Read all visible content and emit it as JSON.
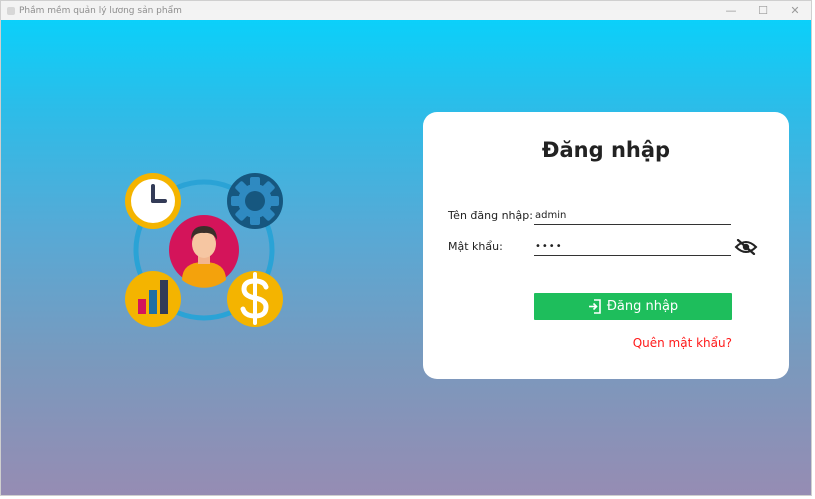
{
  "window": {
    "title": "Phầm mềm quản lý lương sản phẩm",
    "controls": {
      "minimize": "—",
      "maximize": "☐",
      "close": "✕"
    }
  },
  "login": {
    "heading": "Đăng nhập",
    "username_label": "Tên đăng nhập:",
    "username_value": "admin",
    "password_label": "Mật khẩu:",
    "password_value": "••••",
    "submit_label": "Đăng nhập",
    "forgot_label": "Quên mật khẩu?"
  },
  "colors": {
    "background_top": "#0bd0fa",
    "background_bottom": "#968cb3",
    "button": "#1ebe5c",
    "link": "#ff1a1a"
  },
  "icons": {
    "illustration": [
      "clock-icon",
      "gear-icon",
      "user-avatar-icon",
      "bar-chart-icon",
      "dollar-icon"
    ],
    "toggle_password": "eye-slash-icon",
    "login_button": "login-icon"
  }
}
